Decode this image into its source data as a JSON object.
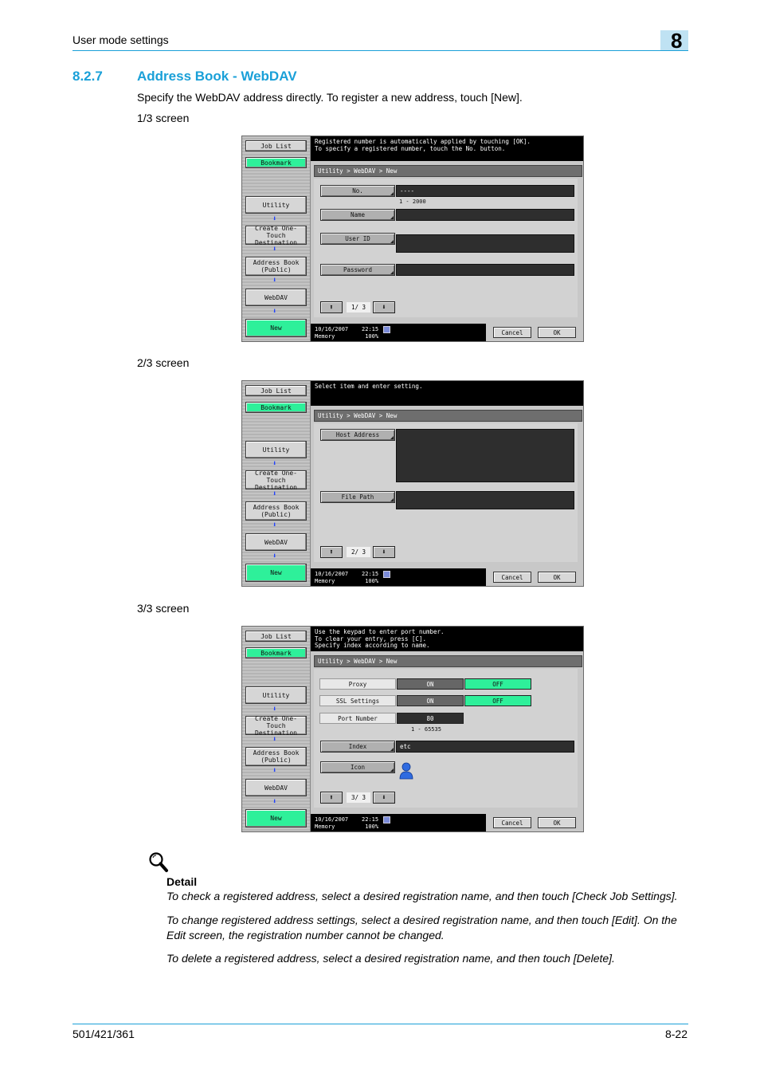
{
  "header": {
    "section_label": "User mode settings",
    "chapter_number": "8"
  },
  "section": {
    "number": "8.2.7",
    "title": "Address Book - WebDAV",
    "intro": "Specify the WebDAV address directly. To register a new address, touch [New]."
  },
  "left_panel": {
    "job_list": "Job List",
    "bookmark": "Bookmark",
    "utility": "Utility",
    "create_one_touch": "Create One-Touch\nDestination",
    "address_book": "Address Book\n(Public)",
    "webdav": "WebDAV",
    "new": "New"
  },
  "common": {
    "breadcrumb": "Utility > WebDAV > New",
    "status": "10/16/2007    22:15\nMemory         100%",
    "cancel": "Cancel",
    "ok": "OK",
    "page_up": "⬆",
    "page_down": "⬇"
  },
  "screen1": {
    "caption": "1/3 screen",
    "message": "Registered number is automatically applied by touching [OK].\nTo specify a registered number, touch the No. button.",
    "no_label": "No.",
    "no_value": "----",
    "no_range": "1 - 2000",
    "name_label": "Name",
    "user_id_label": "User ID",
    "password_label": "Password",
    "page": "1/ 3"
  },
  "screen2": {
    "caption": "2/3 screen",
    "message": "Select item and enter setting.",
    "host_label": "Host Address",
    "path_label": "File Path",
    "page": "2/ 3"
  },
  "screen3": {
    "caption": "3/3 screen",
    "message": "Use the keypad to enter port number.\nTo clear your entry, press [C].\nSpecify index according to name.",
    "proxy_label": "Proxy",
    "ssl_label": "SSL Settings",
    "on": "ON",
    "off": "OFF",
    "port_label": "Port Number",
    "port_value": "80",
    "port_range": "1  -  65535",
    "index_label": "Index",
    "index_value": "etc",
    "icon_label": "Icon",
    "page": "3/ 3"
  },
  "detail": {
    "title": "Detail",
    "p1": "To check a registered address, select a desired registration name, and then touch [Check Job Settings].",
    "p2": "To change registered address settings, select a desired registration name, and then touch [Edit]. On the Edit screen, the registration number cannot be changed.",
    "p3": "To delete a registered address, select a desired registration name, and then touch [Delete]."
  },
  "footer": {
    "model": "501/421/361",
    "page": "8-22"
  },
  "colors": {
    "accent": "#1aa0d8",
    "highlight": "#2ef09a",
    "chapter_box": "#bfe2f3"
  }
}
